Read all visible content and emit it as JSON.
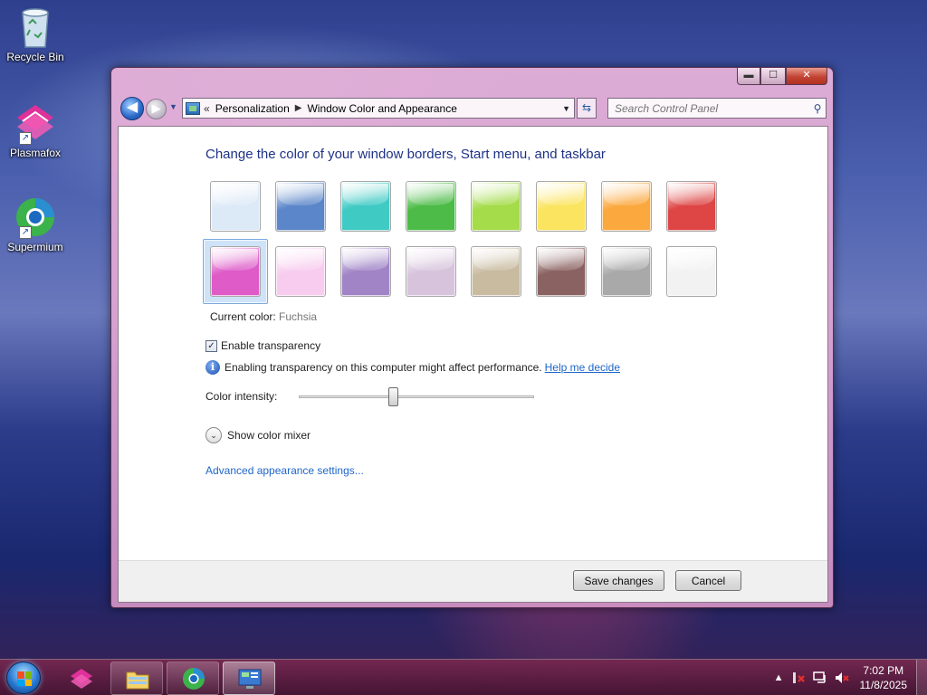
{
  "desktop": {
    "icons": [
      {
        "label": "Recycle Bin",
        "icon": "recycle-bin-icon"
      },
      {
        "label": "Plasmafox",
        "icon": "plasmafox-icon"
      },
      {
        "label": "Supermium",
        "icon": "supermium-icon"
      }
    ]
  },
  "window": {
    "caption_buttons": {
      "minimize": "▬",
      "maximize": "☐",
      "close": "✕"
    },
    "nav": {
      "back": "◀",
      "forward": "▶"
    },
    "breadcrumb": {
      "prefix": "«",
      "items": [
        "Personalization",
        "Window Color and Appearance"
      ],
      "separator": "▶"
    },
    "search": {
      "placeholder": "Search Control Panel"
    },
    "heading": "Change the color of your window borders, Start menu, and taskbar",
    "swatches": [
      {
        "name": "Sky",
        "color": "#dce9f7"
      },
      {
        "name": "Twilight",
        "color": "#5b86c9"
      },
      {
        "name": "Sea",
        "color": "#3fcac4"
      },
      {
        "name": "Leaf",
        "color": "#4cbb47"
      },
      {
        "name": "Lime",
        "color": "#a4dc4a"
      },
      {
        "name": "Lemon",
        "color": "#fbe45f"
      },
      {
        "name": "Pumpkin",
        "color": "#fba83e"
      },
      {
        "name": "Ruby",
        "color": "#de4545"
      },
      {
        "name": "Fuchsia",
        "color": "#de5bc8",
        "selected": true
      },
      {
        "name": "Blush",
        "color": "#f8ccee"
      },
      {
        "name": "Violet",
        "color": "#a084c6"
      },
      {
        "name": "Lavender",
        "color": "#d7c4dc"
      },
      {
        "name": "Taupe",
        "color": "#c8bba0"
      },
      {
        "name": "Chocolate",
        "color": "#8a6261"
      },
      {
        "name": "Slate",
        "color": "#a9a9a9"
      },
      {
        "name": "Frost",
        "color": "#f2f2f2"
      }
    ],
    "current_color_label": "Current color:",
    "current_color_value": "Fuchsia",
    "enable_transparency": {
      "label": "Enable transparency",
      "checked": true,
      "check_glyph": "✓"
    },
    "info_text": "Enabling transparency on this computer might affect performance.",
    "help_link": "Help me decide",
    "intensity": {
      "label": "Color intensity:",
      "value_fraction": 0.4
    },
    "mixer_label": "Show color mixer",
    "mixer_glyph": "⌄",
    "advanced_link": "Advanced appearance settings...",
    "buttons": {
      "save": "Save changes",
      "cancel": "Cancel"
    }
  },
  "taskbar": {
    "items": [
      {
        "name": "plasmafox",
        "icon": "plasmafox-icon",
        "active": false,
        "pinned": true
      },
      {
        "name": "file-explorer",
        "icon": "folder-icon",
        "active": false
      },
      {
        "name": "supermium",
        "icon": "supermium-icon",
        "active": false
      },
      {
        "name": "control-panel",
        "icon": "control-panel-icon",
        "active": true
      }
    ],
    "tray": {
      "arrow": "▲",
      "time": "7:02 PM",
      "date": "11/8/2025"
    }
  },
  "colors": {
    "accent": "#de5bc8",
    "heading": "#1e3287",
    "link": "#1e66c8"
  }
}
